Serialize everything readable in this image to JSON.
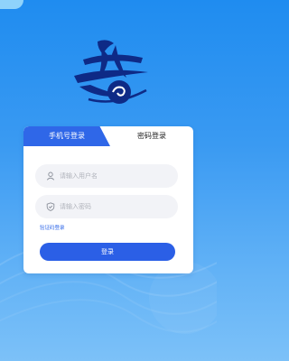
{
  "login": {
    "tabs": [
      {
        "label": "手机号登录",
        "active": true
      },
      {
        "label": "密码登录",
        "active": false
      }
    ],
    "username_field": {
      "placeholder": "请输入用户名",
      "value": "",
      "icon": "user-icon"
    },
    "password_field": {
      "placeholder": "请输入密码",
      "value": "",
      "icon": "shield-icon"
    },
    "code_login_link": "验证码登录",
    "submit_label": "登录"
  },
  "colors": {
    "accent": "#2f67e8",
    "background_top": "#1f8cf0",
    "background_bottom": "#7cc1f8"
  }
}
